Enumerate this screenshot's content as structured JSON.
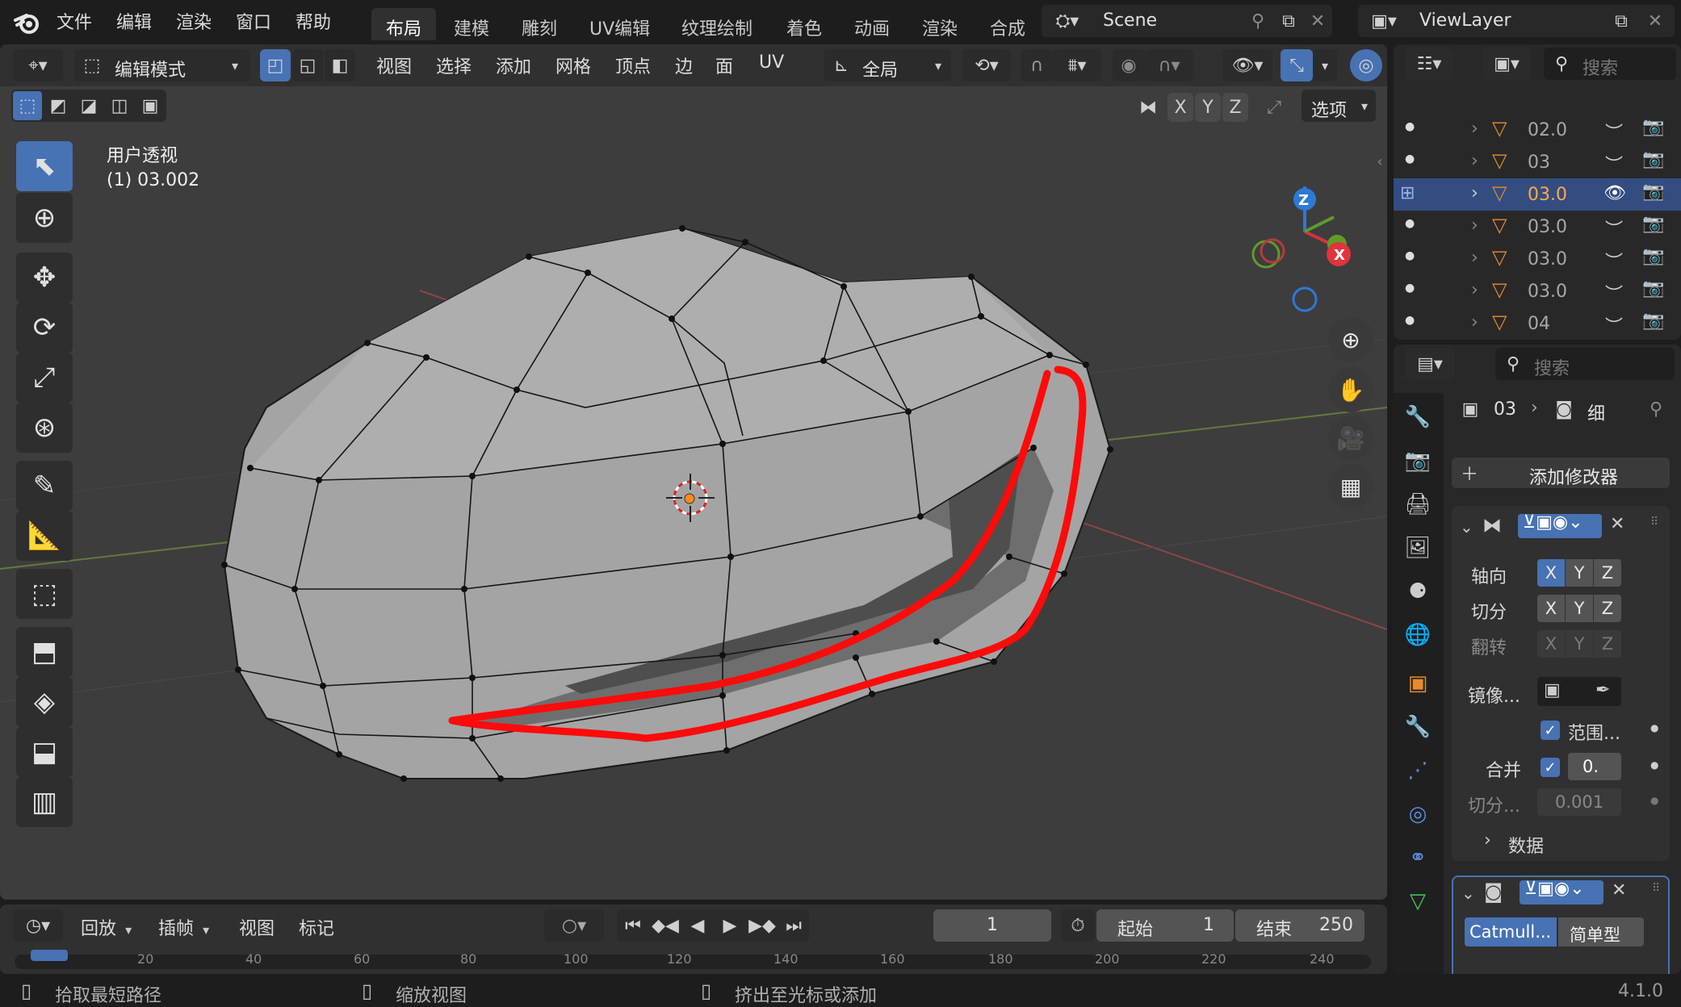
{
  "topbar": {
    "menus": [
      "文件",
      "编辑",
      "渲染",
      "窗口",
      "帮助"
    ],
    "workspaces": [
      "布局",
      "建模",
      "雕刻",
      "UV编辑",
      "纹理绘制",
      "着色",
      "动画",
      "渲染",
      "合成"
    ],
    "active_workspace": "布局",
    "scene": "Scene",
    "view_layer": "ViewLayer"
  },
  "viewport_header": {
    "mode": "编辑模式",
    "menus": [
      "视图",
      "选择",
      "添加",
      "网格",
      "顶点",
      "边",
      "面",
      "UV"
    ],
    "transform_orientation": "全局",
    "mirror_axes": [
      "X",
      "Y",
      "Z"
    ],
    "options_label": "选项"
  },
  "viewport": {
    "view_name": "用户透视",
    "object_info": "(1) 03.002",
    "gizmo": {
      "z": "Z",
      "x": "X"
    }
  },
  "toolbar_tools": [
    "select-box-tool",
    "cursor-tool",
    "move-tool",
    "rotate-tool",
    "scale-tool",
    "transform-tool",
    "annotate-tool",
    "measure-tool",
    "add-cube-tool",
    "extrude-tool",
    "inset-tool",
    "bevel-tool",
    "loop-cut-tool"
  ],
  "outliner": {
    "search_placeholder": "搜索",
    "rows": [
      {
        "name": "02.0",
        "selected": false
      },
      {
        "name": "03",
        "selected": false
      },
      {
        "name": "03.0",
        "selected": true
      },
      {
        "name": "03.0",
        "selected": false
      },
      {
        "name": "03.0",
        "selected": false
      },
      {
        "name": "03.0",
        "selected": false
      },
      {
        "name": "04",
        "selected": false
      }
    ]
  },
  "properties": {
    "search_placeholder": "搜索",
    "breadcrumb_object": "03",
    "breadcrumb_data": "细",
    "add_modifier": "添加修改器",
    "mirror": {
      "axis_label": "轴向",
      "bisect_label": "切分",
      "flip_label": "翻转",
      "mirror_object_label": "镜像...",
      "clipping_label": "范围...",
      "merge_label": "合并",
      "merge_value": "0.",
      "bisect_distance_label": "切分...",
      "bisect_distance_value": "0.001",
      "data_label": "数据"
    },
    "subdivision": {
      "catmull": "Catmull...",
      "simple": "简单型"
    }
  },
  "timeline": {
    "playback": "回放",
    "keying": "插帧",
    "view": "视图",
    "marker": "标记",
    "current_frame": "1",
    "start_label": "起始",
    "start_value": "1",
    "end_label": "结束",
    "end_value": "250",
    "ruler": [
      "20",
      "40",
      "60",
      "80",
      "100",
      "120",
      "140",
      "160",
      "180",
      "200",
      "220",
      "240"
    ]
  },
  "statusbar": {
    "hint1": "拾取最短路径",
    "hint2": "缩放视图",
    "hint3": "挤出至光标或添加",
    "version": "4.1.0"
  },
  "colors": {
    "accent": "#4772b3",
    "selected_orange": "#ffa84d",
    "annotation_red": "#ff0a0a"
  }
}
